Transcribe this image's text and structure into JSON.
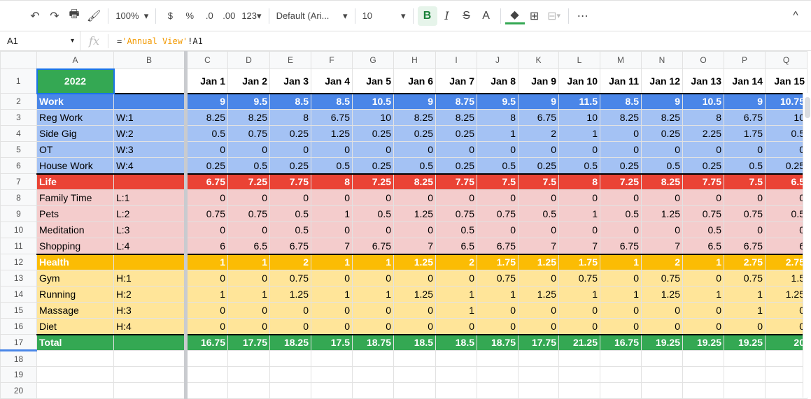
{
  "toolbar": {
    "undo": "↶",
    "redo": "↷",
    "print": "🖶",
    "paint": "🖌",
    "zoom": "100%",
    "currency": "$",
    "percent": "%",
    "dec_less": ".0",
    "dec_more": ".00",
    "format": "123",
    "font": "Default (Ari...",
    "size": "10",
    "bold": "B",
    "italic": "I",
    "strike": "S",
    "textcolor": "A",
    "fill": "◆",
    "borders": "⊞",
    "merge": "⊟",
    "more": "⋯",
    "collapse": "^"
  },
  "formula_bar": {
    "name_box": "A1",
    "fx": "fx",
    "prefix": "=",
    "string": "'Annual View'",
    "suffix": "!A1"
  },
  "columns": [
    "A",
    "B",
    "C",
    "D",
    "E",
    "F",
    "G",
    "H",
    "I",
    "J",
    "K",
    "L",
    "M",
    "N",
    "O",
    "P",
    "Q"
  ],
  "header_row": {
    "year": "2022",
    "dates": [
      "Jan 1",
      "Jan 2",
      "Jan 3",
      "Jan 4",
      "Jan 5",
      "Jan 6",
      "Jan 7",
      "Jan 8",
      "Jan 9",
      "Jan 10",
      "Jan 11",
      "Jan 12",
      "Jan 13",
      "Jan 14",
      "Jan 15"
    ]
  },
  "colors": {
    "work": "#4a86e8",
    "work_light": "#a4c2f4",
    "life": "#ea4335",
    "life_light": "#f4cccc",
    "health": "#fbbc04",
    "health_light": "#ffe599",
    "total": "#34a853",
    "year": "#34a853"
  },
  "rows": [
    {
      "n": "2",
      "label": "Work",
      "code": "",
      "type": "work",
      "values": [
        "9",
        "9.5",
        "8.5",
        "8.5",
        "10.5",
        "9",
        "8.75",
        "9.5",
        "9",
        "11.5",
        "8.5",
        "9",
        "10.5",
        "9",
        "10.75"
      ]
    },
    {
      "n": "3",
      "label": "Reg Work",
      "code": "W:1",
      "type": "work_light",
      "values": [
        "8.25",
        "8.25",
        "8",
        "6.75",
        "10",
        "8.25",
        "8.25",
        "8",
        "6.75",
        "10",
        "8.25",
        "8.25",
        "8",
        "6.75",
        "10"
      ]
    },
    {
      "n": "4",
      "label": "Side Gig",
      "code": "W:2",
      "type": "work_light",
      "values": [
        "0.5",
        "0.75",
        "0.25",
        "1.25",
        "0.25",
        "0.25",
        "0.25",
        "1",
        "2",
        "1",
        "0",
        "0.25",
        "2.25",
        "1.75",
        "0.5"
      ]
    },
    {
      "n": "5",
      "label": "OT",
      "code": "W:3",
      "type": "work_light",
      "values": [
        "0",
        "0",
        "0",
        "0",
        "0",
        "0",
        "0",
        "0",
        "0",
        "0",
        "0",
        "0",
        "0",
        "0",
        "0"
      ]
    },
    {
      "n": "6",
      "label": "House Work",
      "code": "W:4",
      "type": "work_light",
      "values": [
        "0.25",
        "0.5",
        "0.25",
        "0.5",
        "0.25",
        "0.5",
        "0.25",
        "0.5",
        "0.25",
        "0.5",
        "0.25",
        "0.5",
        "0.25",
        "0.5",
        "0.25"
      ]
    },
    {
      "n": "7",
      "label": "Life",
      "code": "",
      "type": "life",
      "values": [
        "6.75",
        "7.25",
        "7.75",
        "8",
        "7.25",
        "8.25",
        "7.75",
        "7.5",
        "7.5",
        "8",
        "7.25",
        "8.25",
        "7.75",
        "7.5",
        "6.5"
      ]
    },
    {
      "n": "8",
      "label": "Family Time",
      "code": "L:1",
      "type": "life_light",
      "values": [
        "0",
        "0",
        "0",
        "0",
        "0",
        "0",
        "0",
        "0",
        "0",
        "0",
        "0",
        "0",
        "0",
        "0",
        "0"
      ]
    },
    {
      "n": "9",
      "label": "Pets",
      "code": "L:2",
      "type": "life_light",
      "values": [
        "0.75",
        "0.75",
        "0.5",
        "1",
        "0.5",
        "1.25",
        "0.75",
        "0.75",
        "0.5",
        "1",
        "0.5",
        "1.25",
        "0.75",
        "0.75",
        "0.5"
      ]
    },
    {
      "n": "10",
      "label": "Meditation",
      "code": "L:3",
      "type": "life_light",
      "values": [
        "0",
        "0",
        "0.5",
        "0",
        "0",
        "0",
        "0.5",
        "0",
        "0",
        "0",
        "0",
        "0",
        "0.5",
        "0",
        "0"
      ]
    },
    {
      "n": "11",
      "label": "Shopping",
      "code": "L:4",
      "type": "life_light",
      "values": [
        "6",
        "6.5",
        "6.75",
        "7",
        "6.75",
        "7",
        "6.5",
        "6.75",
        "7",
        "7",
        "6.75",
        "7",
        "6.5",
        "6.75",
        "6"
      ]
    },
    {
      "n": "12",
      "label": "Health",
      "code": "",
      "type": "health",
      "values": [
        "1",
        "1",
        "2",
        "1",
        "1",
        "1.25",
        "2",
        "1.75",
        "1.25",
        "1.75",
        "1",
        "2",
        "1",
        "2.75",
        "2.75"
      ]
    },
    {
      "n": "13",
      "label": "Gym",
      "code": "H:1",
      "type": "health_light",
      "values": [
        "0",
        "0",
        "0.75",
        "0",
        "0",
        "0",
        "0",
        "0.75",
        "0",
        "0.75",
        "0",
        "0.75",
        "0",
        "0.75",
        "1.5"
      ]
    },
    {
      "n": "14",
      "label": "Running",
      "code": "H:2",
      "type": "health_light",
      "values": [
        "1",
        "1",
        "1.25",
        "1",
        "1",
        "1.25",
        "1",
        "1",
        "1.25",
        "1",
        "1",
        "1.25",
        "1",
        "1",
        "1.25"
      ]
    },
    {
      "n": "15",
      "label": "Massage",
      "code": "H:3",
      "type": "health_light",
      "values": [
        "0",
        "0",
        "0",
        "0",
        "0",
        "0",
        "1",
        "0",
        "0",
        "0",
        "0",
        "0",
        "0",
        "1",
        "0"
      ]
    },
    {
      "n": "16",
      "label": "Diet",
      "code": "H:4",
      "type": "health_light",
      "values": [
        "0",
        "0",
        "0",
        "0",
        "0",
        "0",
        "0",
        "0",
        "0",
        "0",
        "0",
        "0",
        "0",
        "0",
        "0"
      ]
    },
    {
      "n": "17",
      "label": "Total",
      "code": "",
      "type": "total",
      "values": [
        "16.75",
        "17.75",
        "18.25",
        "17.5",
        "18.75",
        "18.5",
        "18.5",
        "18.75",
        "17.75",
        "21.25",
        "16.75",
        "19.25",
        "19.25",
        "19.25",
        "20"
      ]
    }
  ],
  "empty_rows": [
    "18",
    "19",
    "20"
  ]
}
